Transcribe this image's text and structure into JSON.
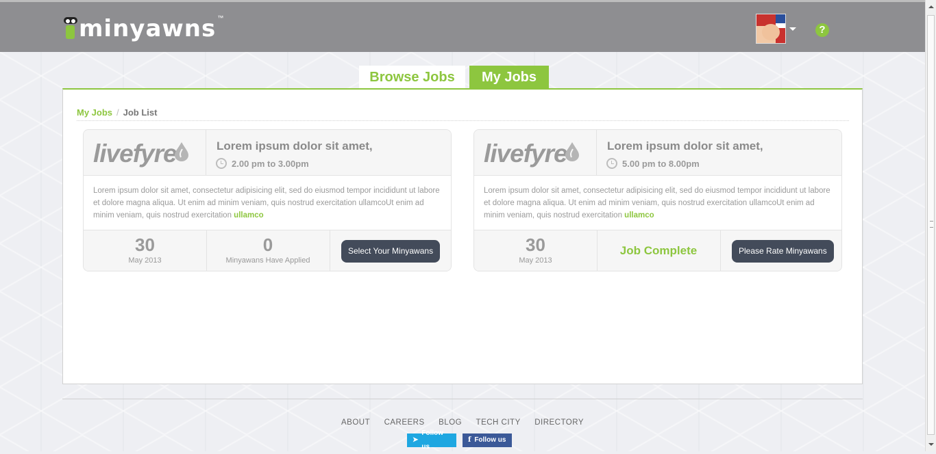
{
  "header": {
    "logo_text": "minyawns",
    "logo_tm": "™",
    "help_icon": "?"
  },
  "tabs": [
    {
      "label": "Browse Jobs",
      "active": false
    },
    {
      "label": "My Jobs",
      "active": true
    }
  ],
  "breadcrumb": {
    "link": "My Jobs",
    "separator": "/",
    "current": "Job List"
  },
  "jobs": [
    {
      "company_logo_text": "livefyre",
      "title": "Lorem ipsum dolor sit amet,",
      "time": "2.00 pm to 3.00pm",
      "description": "Lorem ipsum dolor sit amet, consectetur adipisicing elit, sed do eiusmod tempor incididunt ut labore et dolore magna aliqua. Ut enim ad minim veniam, quis nostrud exercitation ullamcoUt enim ad minim veniam, quis nostrud exercitation ",
      "description_more": "ullamco",
      "day": "30",
      "month_year": "May 2013",
      "applied_count": "0",
      "applied_label": "Minyawans Have Applied",
      "action_label": "Select Your Minyawans"
    },
    {
      "company_logo_text": "livefyre",
      "title": "Lorem ipsum dolor sit amet,",
      "time": "5.00 pm to 8.00pm",
      "description": "Lorem ipsum dolor sit amet, consectetur adipisicing elit, sed do eiusmod tempor incididunt ut labore et dolore magna aliqua. Ut enim ad minim veniam, quis nostrud exercitation ullamcoUt enim ad minim veniam, quis nostrud exercitation ",
      "description_more": "ullamco",
      "day": "30",
      "month_year": "May 2013",
      "status": "Job Complete",
      "action_label": "Please Rate Minyawans"
    }
  ],
  "footer": {
    "links": [
      "ABOUT",
      "CAREERS",
      "BLOG",
      "TECH CITY",
      "DIRECTORY"
    ],
    "twitter_label": "Follow us",
    "facebook_label": "Follow us"
  },
  "colors": {
    "accent": "#8dc63f",
    "topbar": "#8e8e91",
    "button": "#434b5a"
  }
}
